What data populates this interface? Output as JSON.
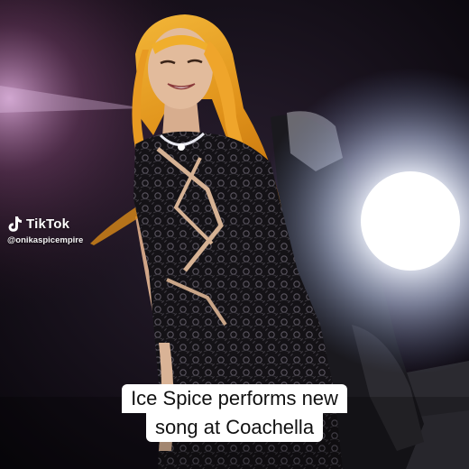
{
  "watermark": {
    "brand": "TikTok",
    "handle": "@onikaspicempire",
    "logo_icon": "tiktok-note-icon"
  },
  "caption": {
    "line1": "Ice Spice performs new",
    "line2": "song at Coachella"
  },
  "colors": {
    "caption_bg": "#ffffff",
    "caption_text": "#111111",
    "hair": "#e39a1c",
    "stage_light": "#ffffff",
    "background": "#0d0a12"
  }
}
